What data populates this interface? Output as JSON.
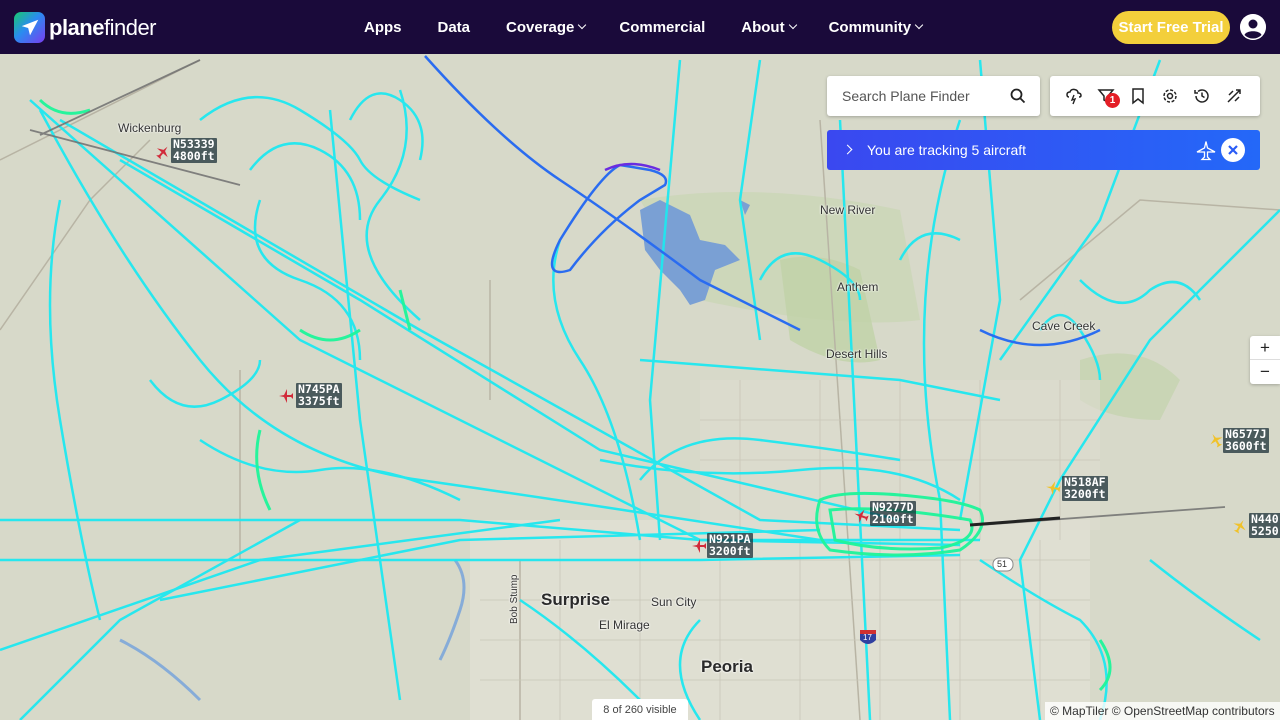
{
  "app": {
    "logo_bold": "plane",
    "logo_thin": "finder"
  },
  "nav": {
    "items": [
      {
        "label": "Apps",
        "dropdown": false
      },
      {
        "label": "Data",
        "dropdown": false
      },
      {
        "label": "Coverage",
        "dropdown": true
      },
      {
        "label": "Commercial",
        "dropdown": false
      },
      {
        "label": "About",
        "dropdown": true
      },
      {
        "label": "Community",
        "dropdown": true
      }
    ],
    "trial_label": "Start Free Trial"
  },
  "search": {
    "placeholder": "Search Plane Finder"
  },
  "toolbar": {
    "tools": [
      "weather-icon",
      "filter-icon",
      "bookmark-icon",
      "settings-icon",
      "history-icon",
      "airport-icon"
    ],
    "filter_badge": "1"
  },
  "tracking": {
    "text": "You are tracking 5 aircraft"
  },
  "zoom": {
    "in_label": "+",
    "out_label": "−"
  },
  "status": {
    "visible": "8 of 260 visible",
    "attribution": "© MapTiler © OpenStreetMap contributors"
  },
  "places": {
    "wickenburg": "Wickenburg",
    "new_river": "New River",
    "anthem": "Anthem",
    "desert_hills": "Desert Hills",
    "cave_creek": "Cave Creek",
    "surprise": "Surprise",
    "sun_city": "Sun City",
    "el_mirage": "El Mirage",
    "peoria": "Peoria",
    "bob_stump": "Bob Stump",
    "road_51": "51",
    "road_17": "17"
  },
  "aircraft": [
    {
      "callsign": "N53339",
      "altitude": "4800ft",
      "color": "#d12b3a"
    },
    {
      "callsign": "N745PA",
      "altitude": "3375ft",
      "color": "#d12b3a"
    },
    {
      "callsign": "N9277D",
      "altitude": "2100ft",
      "color": "#d12b3a"
    },
    {
      "callsign": "N921PA",
      "altitude": "3200ft",
      "color": "#d12b3a"
    },
    {
      "callsign": "N518AF",
      "altitude": "3200ft",
      "color": "#f0c22a"
    },
    {
      "callsign": "N6577J",
      "altitude": "3600ft",
      "color": "#f0c22a"
    },
    {
      "callsign": "N440",
      "altitude": "5250",
      "color": "#f0c22a"
    }
  ],
  "colors": {
    "nav_bg": "#1a0a3a",
    "trial_button": "#f3cf3b",
    "track_cyan": "#1ee8f0",
    "track_green": "#1ef59a",
    "track_blue": "#2a6cf0",
    "tracking_bar": "#2a5cf6"
  }
}
